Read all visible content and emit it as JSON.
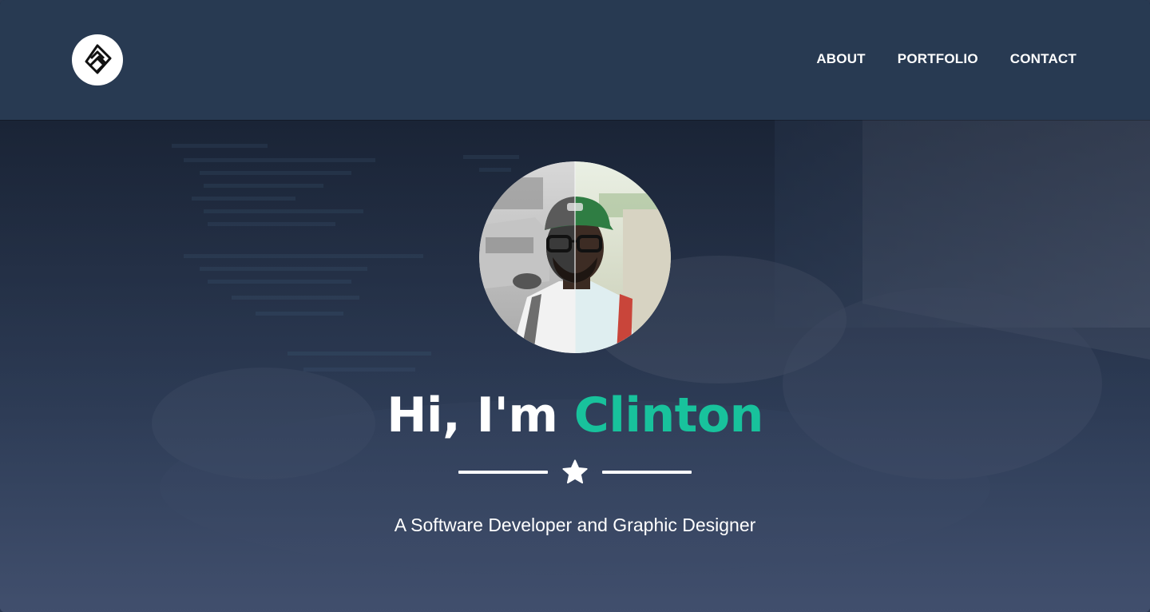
{
  "header": {
    "logo_icon": "monogram-logo-icon",
    "nav": [
      {
        "label": "ABOUT"
      },
      {
        "label": "PORTFOLIO"
      },
      {
        "label": "CONTACT"
      }
    ]
  },
  "hero": {
    "avatar_icon": "profile-photo",
    "greeting": "Hi, I'm",
    "name": "Clinton",
    "divider_icon": "star-icon",
    "subtitle": "A Software Developer and Graphic Designer"
  },
  "colors": {
    "accent": "#18c29c",
    "navbar": "#283a52",
    "text": "#ffffff"
  }
}
